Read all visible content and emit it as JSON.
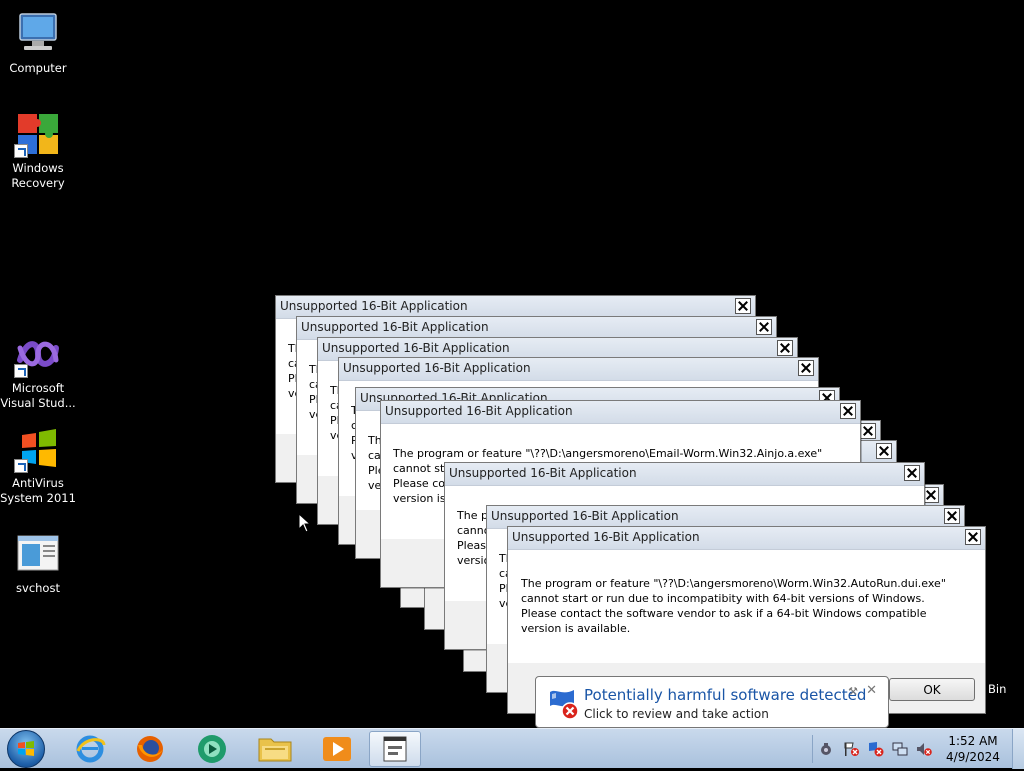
{
  "desktop": {
    "icons": [
      {
        "label": "Computer",
        "icon": "computer-icon"
      },
      {
        "label": "Windows Recovery",
        "icon": "puzzle-icon"
      },
      {
        "label": "Microsoft Visual Stud...",
        "icon": "visual-studio-icon"
      },
      {
        "label": "AntiVirus System 2011",
        "icon": "windows-flag-icon"
      },
      {
        "label": "svchost",
        "icon": "window-app-icon"
      }
    ],
    "recycle_bin_label": "Bin"
  },
  "dialogs": {
    "title": "Unsupported 16-Bit Application",
    "back_message": "The program or feature \"\\??\\D:\\angersmoreno\\Email-Worm.Win32.Ainjo.a.exe\" cannot start or run due to incompatibility with 64-bit versions of Windows. Please contact the software vendor to ask if a 64-bit Windows compatible version is available.",
    "front_message": "The program or feature \"\\??\\D:\\angersmoreno\\Worm.Win32.AutoRun.dui.exe\" cannot start or run due to incompatibity with 64-bit versions of Windows. Please contact the software vendor to ask if a 64-bit Windows compatible version is available.",
    "ok_label": "OK"
  },
  "balloon": {
    "title": "Potentially harmful software detected",
    "subtitle": "Click to review and take action",
    "icon": "shield-warning-icon"
  },
  "taskbar": {
    "start": "start-orb-icon",
    "pinned": [
      "internet-explorer-icon",
      "firefox-icon",
      "media-center-icon",
      "explorer-folder-icon",
      "media-player-icon",
      "active-window-icon"
    ],
    "tray": [
      "security-icon",
      "action-center-icon",
      "defender-alert-icon",
      "network-icon",
      "volume-muted-icon"
    ],
    "clock_time": "1:52 AM",
    "clock_date": "4/9/2024"
  },
  "colors": {
    "accent": "#1c63b8",
    "taskbar": "#b9cde4",
    "title_text": "#1a55a6"
  }
}
